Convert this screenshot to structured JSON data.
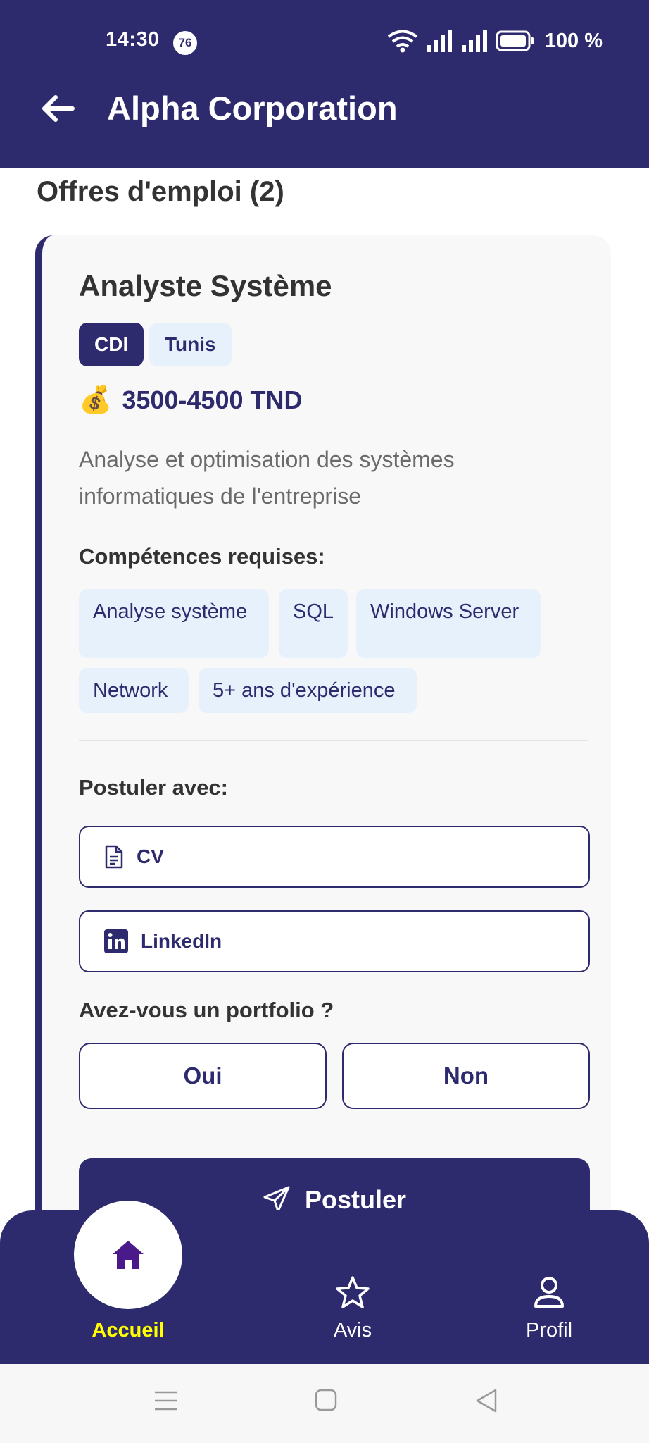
{
  "status_bar": {
    "time": "14:30",
    "notification_count": "76",
    "battery": "100 %"
  },
  "header": {
    "title": "Alpha Corporation",
    "back_icon": "arrow-left-icon"
  },
  "section": {
    "title": "Offres d'emploi (2)"
  },
  "job": {
    "title": "Analyste Système",
    "contract_type": "CDI",
    "location": "Tunis",
    "salary": "3500-4500 TND",
    "salary_icon": "money-bag-icon",
    "description": "Analyse et optimisation des systèmes informatiques de l'entreprise",
    "skills_label": "Compétences requises:",
    "skills": [
      "Analyse système",
      "SQL",
      "Windows Server",
      "Network",
      "5+ ans d'expérience"
    ],
    "apply_with_label": "Postuler avec:",
    "apply_options": [
      {
        "label": "CV",
        "icon": "document-icon"
      },
      {
        "label": "LinkedIn",
        "icon": "linkedin-icon"
      }
    ],
    "portfolio_question": "Avez-vous un portfolio ?",
    "portfolio_yes": "Oui",
    "portfolio_no": "Non",
    "submit_label": "Postuler",
    "submit_icon": "send-icon"
  },
  "bottom_nav": {
    "items": [
      {
        "label": "Accueil",
        "icon": "home-icon",
        "active": true
      },
      {
        "label": "Avis",
        "icon": "star-icon",
        "active": false
      },
      {
        "label": "Profil",
        "icon": "user-icon",
        "active": false
      }
    ]
  },
  "colors": {
    "primary": "#2e2a6e",
    "chip_bg": "#e6f1fc",
    "active_nav": "#ffff00"
  }
}
